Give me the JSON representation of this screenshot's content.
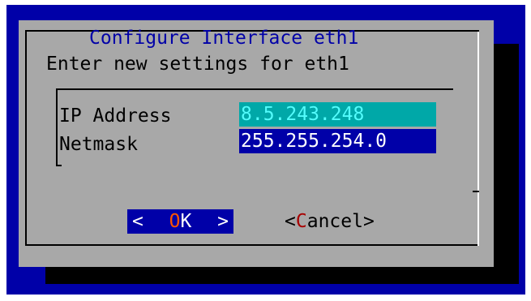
{
  "dialog": {
    "title": "Configure Interface eth1",
    "prompt": "Enter new settings for eth1"
  },
  "form": {
    "fields": [
      {
        "label": "IP Address",
        "value": "8.5.243.248",
        "focused": true
      },
      {
        "label": "Netmask",
        "value": "255.255.254.0",
        "focused": false
      }
    ]
  },
  "buttons": {
    "ok": {
      "left_bracket": "<",
      "hotkey": "O",
      "rest": "K",
      "right_bracket": ">"
    },
    "cancel": {
      "left_bracket": "<",
      "hotkey": "C",
      "rest": "ancel",
      "right_bracket": ">"
    }
  },
  "colors": {
    "background": "#0000a8",
    "dialog": "#a8a8a8",
    "title": "#0000a8",
    "field_focused": "#00a8a8",
    "field_focused_text": "#54fcfc",
    "field": "#0000a8",
    "hotkey_selected": "#fc5400",
    "hotkey": "#a80000"
  }
}
